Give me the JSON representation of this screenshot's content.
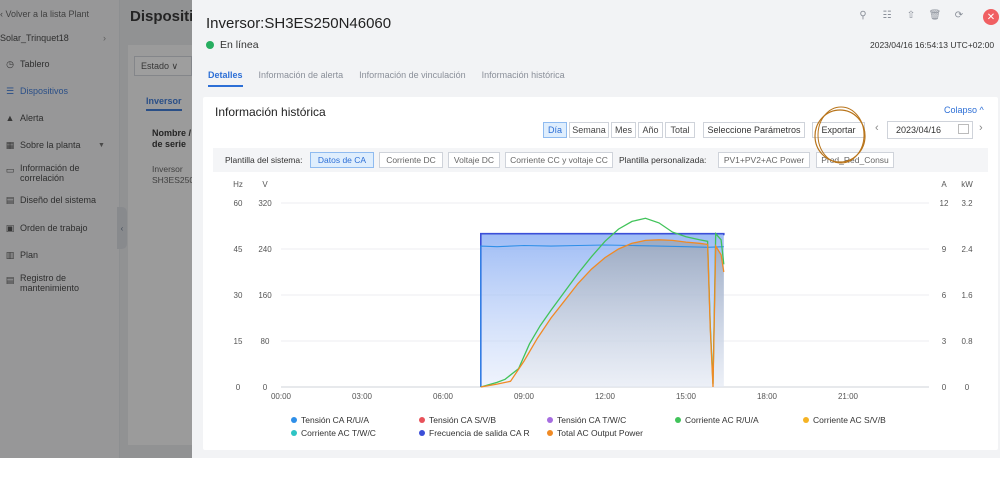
{
  "sidebar": {
    "back_link": "‹ Volver a la lista Plant",
    "plant_name": "Solar_Trinquet18",
    "items": [
      {
        "label": "Tablero",
        "icon": "dashboard-icon"
      },
      {
        "label": "Dispositivos",
        "icon": "devices-icon",
        "active": true
      },
      {
        "label": "Alerta",
        "icon": "alert-icon"
      },
      {
        "label": "Sobre la planta",
        "icon": "plant-icon"
      },
      {
        "label": "Información de correlación",
        "icon": "correlation-icon"
      },
      {
        "label": "Diseño del sistema",
        "icon": "system-design-icon"
      },
      {
        "label": "Orden de trabajo",
        "icon": "work-order-icon"
      },
      {
        "label": "Plan",
        "icon": "plan-icon"
      },
      {
        "label": "Registro de mantenimiento",
        "icon": "maintenance-log-icon"
      }
    ]
  },
  "background": {
    "title": "Dispositiv",
    "filter": "Estado ∨",
    "tab": "Inversor",
    "col_header": "Nombre / de serie",
    "row": "Inversor SH3ES250"
  },
  "drawer": {
    "title": "Inversor:SH3ES250N46060",
    "status": "En línea",
    "status_color": "#27ae60",
    "timestamp": "2023/04/16 16:54:13 UTC+02:00",
    "tabs": [
      "Detalles",
      "Información de alerta",
      "Información de vinculación",
      "Información histórica"
    ],
    "active_tab": 0
  },
  "card": {
    "title": "Información histórica",
    "collapse": "Colapso",
    "periods": [
      "Día",
      "Semana",
      "Mes",
      "Año",
      "Total"
    ],
    "active_period": 0,
    "select_params": "Seleccione Parámetros",
    "export": "Exportar",
    "date": "2023/04/16",
    "system_template_label": "Plantilla del sistema:",
    "system_templates": [
      "Datos de CA",
      "Corriente DC",
      "Voltaje DC",
      "Corriente CC y voltaje CC"
    ],
    "active_template": 0,
    "custom_template_label": "Plantilla personalizada:",
    "custom_templates": [
      "PV1+PV2+AC Power",
      "Prod_Red_Consu"
    ]
  },
  "colors": {
    "accent": "#2d6fd6",
    "blue_series": "#5a7fe0",
    "green_series": "#41c35a",
    "orange_series": "#f08a24",
    "close": "#f05f62"
  },
  "chart_data": {
    "type": "line",
    "x_ticks": [
      "00:00",
      "03:00",
      "06:00",
      "09:00",
      "12:00",
      "15:00",
      "18:00",
      "21:00"
    ],
    "y_left_units": [
      "Hz",
      "V"
    ],
    "y_left_hz_ticks": [
      "60",
      "45",
      "30",
      "15",
      "0"
    ],
    "y_left_v_ticks": [
      "320",
      "240",
      "160",
      "80",
      "0"
    ],
    "y_right_units": [
      "A",
      "kW"
    ],
    "y_right_a_ticks": [
      "12",
      "9",
      "6",
      "3",
      "0"
    ],
    "y_right_kw_ticks": [
      "3.2",
      "2.4",
      "1.6",
      "0.8",
      "0"
    ],
    "series": [
      {
        "name": "Tensión CA R/U/A",
        "color": "#2f8fe8",
        "points": [
          [
            7.4,
            0
          ],
          [
            7.4,
            245
          ],
          [
            8,
            244
          ],
          [
            9,
            246
          ],
          [
            10,
            245
          ],
          [
            11,
            246
          ],
          [
            12,
            247
          ],
          [
            13,
            246
          ],
          [
            14,
            245
          ],
          [
            15,
            244
          ],
          [
            15.8,
            243
          ],
          [
            16.4,
            244
          ]
        ]
      },
      {
        "name": "Tensión CA S/V/B",
        "color": "#e8525a",
        "points": []
      },
      {
        "name": "Tensión CA T/W/C",
        "color": "#a66de0",
        "points": []
      },
      {
        "name": "Corriente AC R/U/A",
        "color": "#41c35a",
        "points": [
          [
            7.4,
            0
          ],
          [
            8,
            0.3
          ],
          [
            8.3,
            0.5
          ],
          [
            8.8,
            1.2
          ],
          [
            9.2,
            2.8
          ],
          [
            9.6,
            4.0
          ],
          [
            10,
            5.0
          ],
          [
            10.5,
            6.2
          ],
          [
            11,
            7.4
          ],
          [
            11.5,
            8.5
          ],
          [
            12,
            9.5
          ],
          [
            12.5,
            10.3
          ],
          [
            13,
            10.8
          ],
          [
            13.5,
            11.0
          ],
          [
            14,
            10.7
          ],
          [
            14.5,
            10.1
          ],
          [
            15,
            9.8
          ],
          [
            15.5,
            9.6
          ],
          [
            15.8,
            9.5
          ],
          [
            15.9,
            4.0
          ],
          [
            16.0,
            0.2
          ],
          [
            16.1,
            10.0
          ],
          [
            16.3,
            9.6
          ],
          [
            16.4,
            8.0
          ]
        ]
      },
      {
        "name": "Corriente AC S/V/B",
        "color": "#f5b324",
        "points": []
      },
      {
        "name": "Corriente AC T/W/C",
        "color": "#2ec4c4",
        "points": []
      },
      {
        "name": "Frecuencia de salida CA R",
        "color": "#3b4fd8",
        "points": [
          [
            7.4,
            0
          ],
          [
            7.4,
            50
          ],
          [
            16.4,
            50
          ],
          [
            16.4,
            49.5
          ]
        ]
      },
      {
        "name": "Total AC Output Power",
        "color": "#f08a24",
        "points": [
          [
            7.4,
            0
          ],
          [
            8,
            0.05
          ],
          [
            8.5,
            0.1
          ],
          [
            9,
            0.45
          ],
          [
            9.5,
            0.85
          ],
          [
            10,
            1.2
          ],
          [
            10.5,
            1.5
          ],
          [
            11,
            1.8
          ],
          [
            11.5,
            2.05
          ],
          [
            12,
            2.25
          ],
          [
            12.5,
            2.4
          ],
          [
            13,
            2.5
          ],
          [
            13.5,
            2.55
          ],
          [
            14,
            2.56
          ],
          [
            14.5,
            2.55
          ],
          [
            15,
            2.52
          ],
          [
            15.5,
            2.5
          ],
          [
            15.8,
            2.48
          ],
          [
            15.9,
            1.0
          ],
          [
            16.0,
            0.0
          ],
          [
            16.1,
            2.45
          ],
          [
            16.3,
            2.3
          ],
          [
            16.4,
            2.0
          ]
        ]
      }
    ],
    "ylim_left_v": [
      0,
      320
    ],
    "ylim_left_hz": [
      0,
      60
    ],
    "ylim_right_a": [
      0,
      12
    ],
    "ylim_right_kw": [
      0,
      3.2
    ],
    "xlim_hours": [
      0,
      24
    ],
    "grid": true,
    "legend_position": "bottom"
  }
}
